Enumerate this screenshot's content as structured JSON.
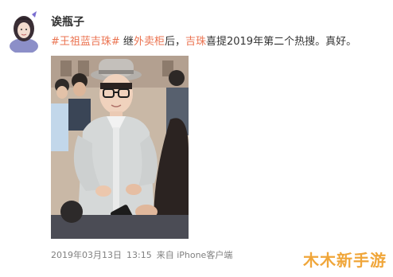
{
  "post": {
    "author": "诶瓶子",
    "content": {
      "topic1": "#王祖蓝吉珠#",
      "text1": " 继",
      "link1": "外卖柜",
      "text2": "后，",
      "link2": "吉珠",
      "text3": "喜提2019年第二个热搜。真好。"
    },
    "meta": {
      "date": "2019年03月13日",
      "time": "13:15",
      "source": "来自 iPhone客户端"
    }
  },
  "watermark": "木木新手游",
  "colors": {
    "link": "#eb7350",
    "text": "#333333",
    "meta": "#808080",
    "watermark": "#f0a63a"
  }
}
